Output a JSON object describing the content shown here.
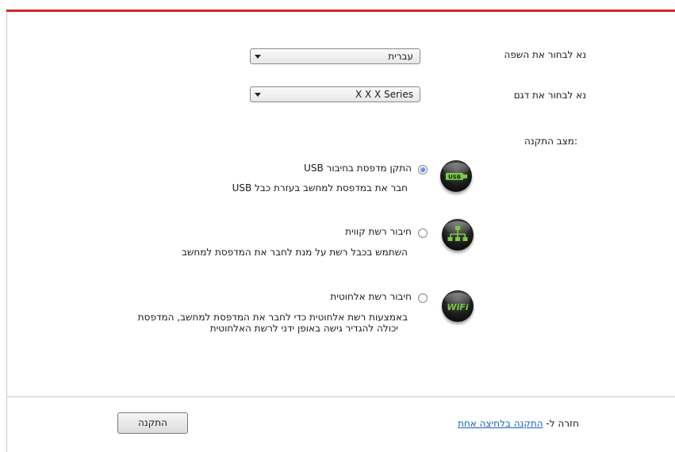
{
  "language": {
    "label": "נא לבחור את השפה",
    "selected": "עברית"
  },
  "model": {
    "label": "נא לבחור את דגם",
    "selected": "X X X Series"
  },
  "install_mode": {
    "label": ":מצב התקנה",
    "options": [
      {
        "title": "התקן מדפסת בחיבור USB",
        "description_lines": [
          "חבר את במדפסת למחשב בעזרת כבל USB"
        ],
        "icon": "usb-icon",
        "icon_text": "USB",
        "checked": true
      },
      {
        "title": "חיבור רשת קווית",
        "description_lines": [
          "השתמש בכבל רשת על מנת לחבר את המדפסת למחשב"
        ],
        "icon": "wired-network-icon",
        "checked": false
      },
      {
        "title": "חיבור רשת אלחוטית",
        "description_lines": [
          "באמצעות רשת אלחוטית כדי לחבר את המדפסת למחשב, המדפסת",
          "יכולה להגדיר גישה באופן ידני לרשת האלחוטית"
        ],
        "icon": "wifi-icon",
        "icon_text": "WiFi",
        "checked": false
      }
    ]
  },
  "footer": {
    "back_prefix": "חזרה ל-",
    "back_link": "התקנה בלחיצה אחת",
    "install_button": "התקנה"
  },
  "colors": {
    "accent_top_bar": "#d2262c",
    "link": "#1a5fc2",
    "icon_green": "#7ac943"
  }
}
